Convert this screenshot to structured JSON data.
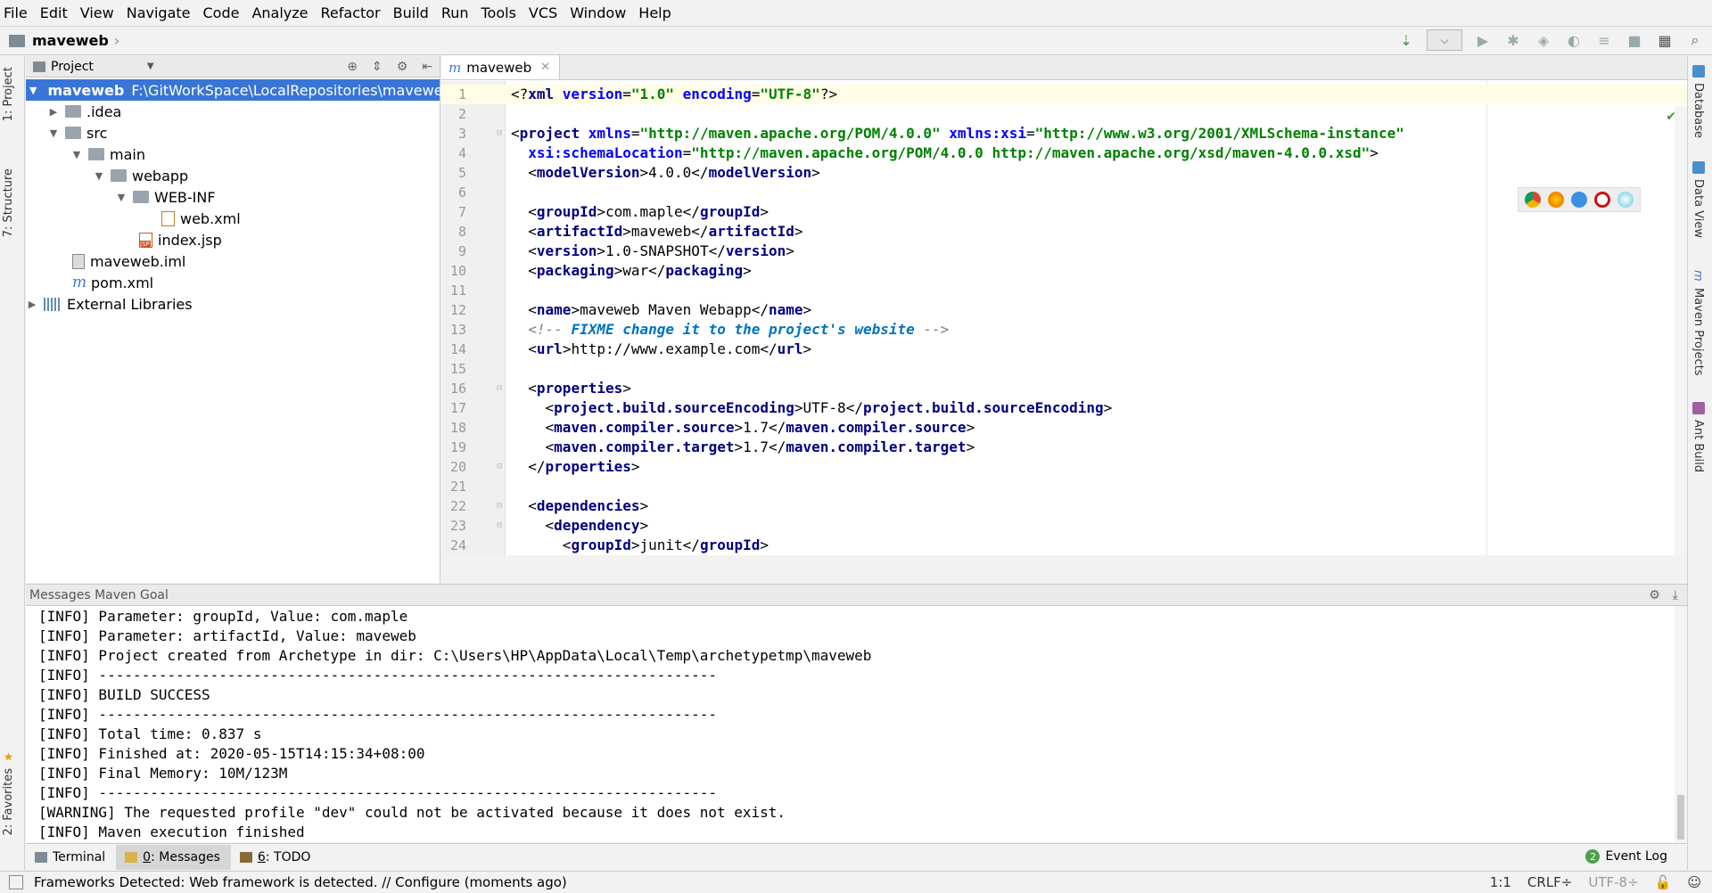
{
  "menu": [
    "File",
    "Edit",
    "View",
    "Navigate",
    "Code",
    "Analyze",
    "Refactor",
    "Build",
    "Run",
    "Tools",
    "VCS",
    "Window",
    "Help"
  ],
  "breadcrumb": {
    "project": "maveweb"
  },
  "toolbar": {
    "dropdown_arrow": "⌵"
  },
  "left_tabs": {
    "project": "1: Project",
    "structure": "7: Structure",
    "favorites": "2: Favorites"
  },
  "right_tabs": {
    "database": "Database",
    "dataview": "Data View",
    "maven": "Maven Projects",
    "ant": "Ant Build"
  },
  "project_panel": {
    "title": "Project",
    "tree": [
      {
        "name": "maveweb",
        "path": "F:\\GitWorkSpace\\LocalRepositories\\maveweb"
      },
      {
        "name": ".idea"
      },
      {
        "name": "src"
      },
      {
        "name": "main"
      },
      {
        "name": "webapp"
      },
      {
        "name": "WEB-INF"
      },
      {
        "name": "web.xml"
      },
      {
        "name": "index.jsp"
      },
      {
        "name": "maveweb.iml"
      },
      {
        "name": "pom.xml"
      },
      {
        "name": "External Libraries"
      }
    ]
  },
  "editor": {
    "tab": "maveweb",
    "line_numbers": [
      "1",
      "2",
      "3",
      "4",
      "5",
      "6",
      "7",
      "8",
      "9",
      "10",
      "11",
      "12",
      "13",
      "14",
      "15",
      "16",
      "17",
      "18",
      "19",
      "20",
      "21",
      "22",
      "23",
      "24"
    ]
  },
  "messages": {
    "title": "Messages Maven Goal",
    "lines": [
      "[INFO] Parameter: groupId, Value: com.maple",
      "[INFO] Parameter: artifactId, Value: maveweb",
      "[INFO] Project created from Archetype in dir: C:\\Users\\HP\\AppData\\Local\\Temp\\archetypetmp\\maveweb",
      "[INFO] ------------------------------------------------------------------------",
      "[INFO] BUILD SUCCESS",
      "[INFO] ------------------------------------------------------------------------",
      "[INFO] Total time: 0.837 s",
      "[INFO] Finished at: 2020-05-15T14:15:34+08:00",
      "[INFO] Final Memory: 10M/123M",
      "[INFO] ------------------------------------------------------------------------",
      "[WARNING] The requested profile \"dev\" could not be activated because it does not exist.",
      "[INFO] Maven execution finished"
    ]
  },
  "tool_tabs": {
    "terminal": "Terminal",
    "messages_num": "0",
    "messages": ": Messages",
    "todo_num": "6",
    "todo": ": TODO",
    "event_count": "2",
    "event_log": "Event Log"
  },
  "status": {
    "message": "Frameworks Detected: Web framework is detected. // Configure (moments ago)",
    "position": "1:1",
    "line_sep": "CRLF÷",
    "encoding": "UTF-8÷"
  }
}
